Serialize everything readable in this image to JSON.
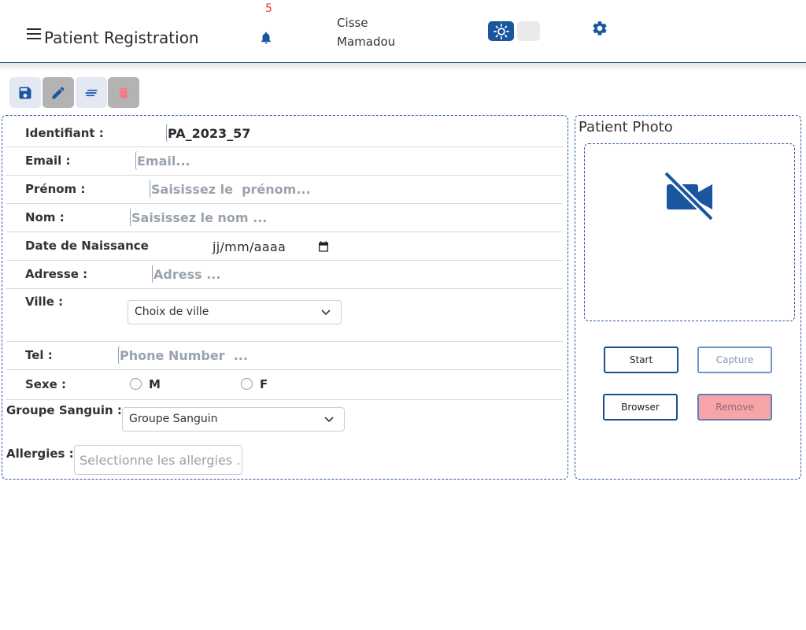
{
  "header": {
    "title": "Patient Registration",
    "notification_count": "5",
    "user": {
      "first_name": "Cisse",
      "last_name": "Mamadou"
    },
    "icons": [
      "menu-icon",
      "bell-icon",
      "sun-icon",
      "moon-icon",
      "gear-icon"
    ]
  },
  "toolbar": {
    "buttons": [
      {
        "name": "save",
        "icon": "save-icon"
      },
      {
        "name": "edit",
        "icon": "pencil-icon"
      },
      {
        "name": "list",
        "icon": "list-icon"
      },
      {
        "name": "delete",
        "icon": "trash-icon"
      }
    ]
  },
  "form": {
    "identifiant": {
      "label": "Identifiant :",
      "value": "PA_2023_57"
    },
    "email": {
      "label": "Email :",
      "placeholder": "Email..."
    },
    "prenom": {
      "label": "Prénom :",
      "placeholder": "Saisissez le  prénom..."
    },
    "nom": {
      "label": "Nom :",
      "placeholder": "Saisissez le nom ..."
    },
    "date_naissance": {
      "label": "Date de Naissance",
      "placeholder": "jj/mm/aaaa"
    },
    "adresse": {
      "label": "Adresse :",
      "placeholder": "Adress ..."
    },
    "ville": {
      "label": "Ville :",
      "selected": "Choix de ville"
    },
    "tel": {
      "label": "Tel :",
      "placeholder": "Phone Number  ..."
    },
    "sexe": {
      "label": "Sexe :",
      "options": [
        "M",
        "F"
      ]
    },
    "groupe_sanguin": {
      "label": "Groupe Sanguin :",
      "selected": "Groupe Sanguin"
    },
    "allergies": {
      "label": "Allergies :",
      "placeholder": "Selectionne les allergies .."
    }
  },
  "photo": {
    "title": "Patient Photo",
    "placeholder_icon": "camera-off-icon",
    "buttons": {
      "start": "Start",
      "capture": "Capture",
      "browser": "Browser",
      "remove": "Remove"
    }
  },
  "colors": {
    "accent": "#1a55a0",
    "notification": "#e53935",
    "remove_bg": "#f6a4a8",
    "delete_icon": "#f57b83"
  }
}
